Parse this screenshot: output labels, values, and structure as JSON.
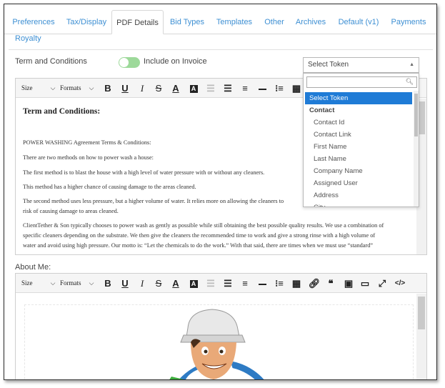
{
  "tabs": [
    "Preferences",
    "Tax/Display",
    "PDF Details",
    "Bid Types",
    "Templates",
    "Other",
    "Archives",
    "Default (v1)",
    "Payments"
  ],
  "tabs_row2": [
    "Royalty"
  ],
  "terms": {
    "label": "Term and Conditions",
    "toggle_label": "Include on Invoice",
    "toggle_on": true,
    "toggle_color": "#9dd99a"
  },
  "token_select": {
    "label": "Select Token",
    "search_value": "",
    "options": [
      {
        "text": "Select Token",
        "kind": "highlight"
      },
      {
        "text": "Contact",
        "kind": "group"
      },
      {
        "text": "Contact Id",
        "kind": "option"
      },
      {
        "text": "Contact Link",
        "kind": "option"
      },
      {
        "text": "First Name",
        "kind": "option"
      },
      {
        "text": "Last Name",
        "kind": "option"
      },
      {
        "text": "Company Name",
        "kind": "option"
      },
      {
        "text": "Assigned User",
        "kind": "option"
      },
      {
        "text": "Address",
        "kind": "option"
      },
      {
        "text": "City",
        "kind": "option"
      }
    ],
    "highlight_color": "#1f7bd6"
  },
  "toolbar": {
    "size_label": "Size",
    "formats_label": "Formats",
    "icons": [
      "bold-icon",
      "underline-icon",
      "italic-icon",
      "strikethrough-icon",
      "font-color-icon",
      "background-color-icon",
      "outdent-icon",
      "indent-icon",
      "align-icon",
      "horizontal-rule-icon",
      "numbered-list-icon",
      "table-icon",
      "link-icon",
      "quote-icon",
      "image-icon",
      "video-icon",
      "fullscreen-icon",
      "code-view-icon"
    ]
  },
  "terms_doc": {
    "heading": "Term and Conditions:",
    "paragraphs": [
      "POWER WASHING Agreement Terms & Conditions:",
      "There are two methods on how to power wash a house:",
      "The first method is to blast the house with a high level of water pressure with or without any cleaners.",
      "This method has a higher chance of causing damage to the areas cleaned.",
      "The second method uses less pressure, but a higher volume of water.  It relies more on allowing the cleaners to",
      "risk of causing damage to areas cleaned.",
      "ClientTether & Son typically chooses to power wash as gently as possible while still obtaining the best possible quality results.  We use a combination of",
      "specific cleaners depending on the substrate.  We then give the cleaners the recommended time to work and give a strong rinse with a high volume of",
      "water and avoid using high pressure.  Our motto is: “Let the chemicals to do the work.”  With that said, there are times when we must use “standard”"
    ]
  },
  "about": {
    "label": "About Me:"
  }
}
